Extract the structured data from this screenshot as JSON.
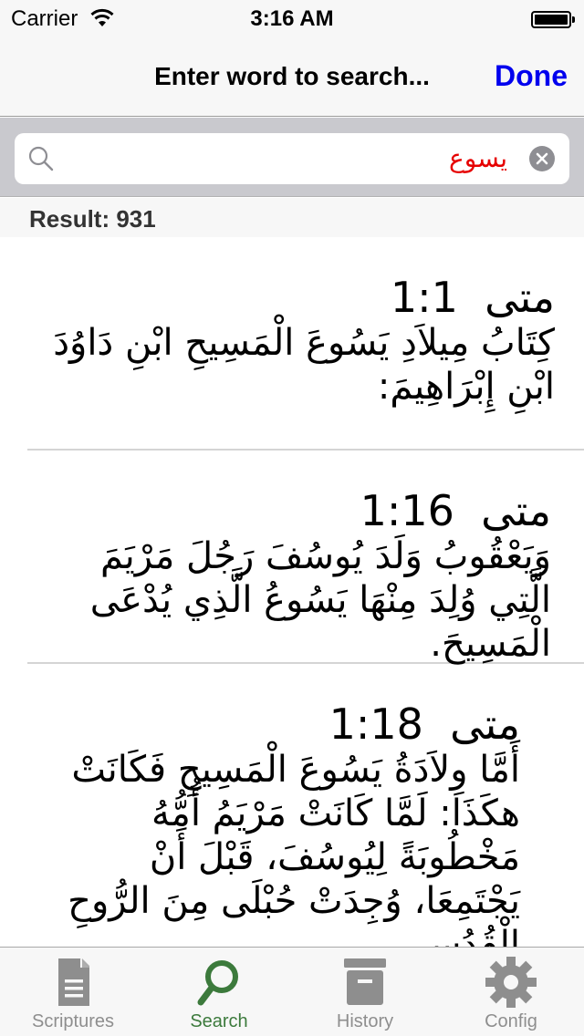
{
  "status_bar": {
    "carrier": "Carrier",
    "time": "3:16 AM",
    "battery_level": 1.0
  },
  "nav_bar": {
    "title": "Enter word to search...",
    "done_label": "Done",
    "done_color": "#0000ee"
  },
  "search": {
    "value": "يسوع",
    "value_color": "#e60000",
    "search_icon": "magnifier-icon",
    "clear_icon": "clear-x-icon"
  },
  "result": {
    "label": "Result: 931"
  },
  "verses": [
    {
      "book": "متى",
      "ref": "1:1",
      "text": "كِتَابُ مِيلاَدِ يَسُوعَ الْمَسِيحِ ابْنِ دَاوُدَ ابْنِ إِبْرَاهِيمَ:"
    },
    {
      "book": "متى",
      "ref": "1:16",
      "text": "وَيَعْقُوبُ وَلَدَ يُوسُفَ رَجُلَ مَرْيَمَ الَّتِي وُلِدَ مِنْهَا يَسُوعُ الَّذِي يُدْعَى الْمَسِيحَ."
    },
    {
      "book": "متى",
      "ref": "1:18",
      "text": "أَمَّا وِلاَدَةُ يَسُوعَ الْمَسِيحِ فَكَانَتْ هكَذَا: لَمَّا كَانَتْ مَرْيَمُ أُمُّهُ مَخْطُوبَةً لِيُوسُفَ، قَبْلَ أَنْ يَجْتَمِعَا، وُجِدَتْ حُبْلَى مِنَ الرُّوحِ الْقُدُسِ."
    }
  ],
  "tab_bar": {
    "active_color": "#3c7a3c",
    "inactive_color": "#8e8e8e",
    "tabs": [
      {
        "label": "Scriptures",
        "icon": "document-icon",
        "active": false
      },
      {
        "label": "Search",
        "icon": "search-icon",
        "active": true
      },
      {
        "label": "History",
        "icon": "archive-box-icon",
        "active": false
      },
      {
        "label": "Config",
        "icon": "gear-icon",
        "active": false
      }
    ]
  }
}
